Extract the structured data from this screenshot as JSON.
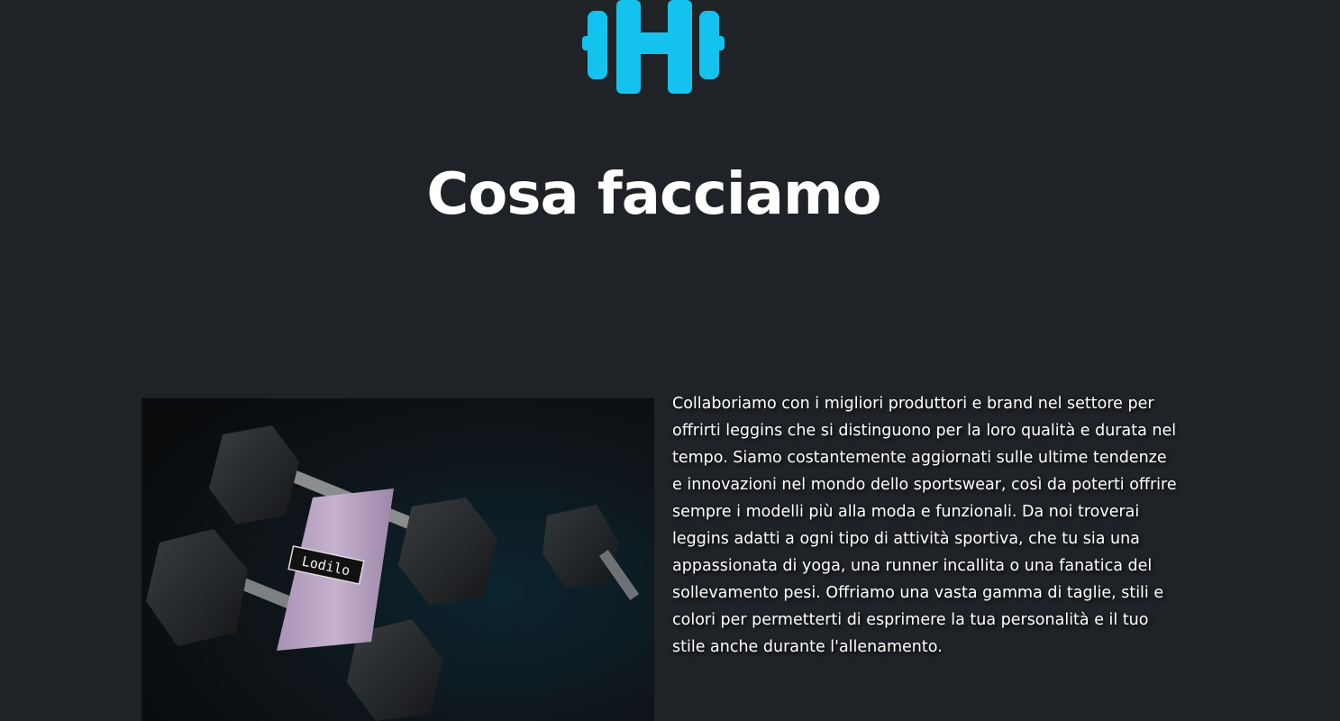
{
  "logo": {
    "icon": "dumbbell-h-logo",
    "color": "#13c3ee"
  },
  "section": {
    "title": "Cosa facciamo",
    "image_label": "Lodilo",
    "description": "Collaboriamo con i migliori produttori e brand nel settore per offrirti leggins che si distinguono per la loro qualità e durata nel tempo. Siamo costantemente aggiornati sulle ultime tendenze e innovazioni nel mondo dello sportswear, così da poterti offrire sempre i modelli più alla moda e funzionali. Da noi troverai leggins adatti a ogni tipo di attività sportiva, che tu sia una appassionata di yoga, una runner incallita o una fanatica del sollevamento pesi. Offriamo una vasta gamma di taglie, stili e colori per permetterti di esprimere la tua personalità e il tuo stile anche durante l'allenamento."
  },
  "colors": {
    "background": "#1f2227",
    "accent": "#13c3ee",
    "text": "#ffffff"
  }
}
